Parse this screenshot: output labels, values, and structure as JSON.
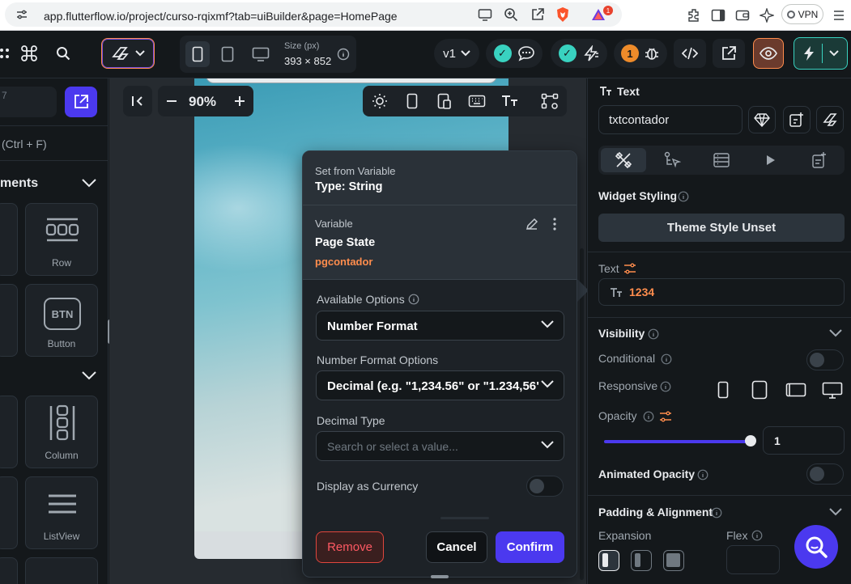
{
  "browser": {
    "url": "app.flutterflow.io/project/curso-rqixmf?tab=uiBuilder&page=HomePage",
    "vpn_label": "VPN",
    "badge_count": "1"
  },
  "toolbar": {
    "size_label": "Size (px)",
    "size_value": "393 × 852",
    "version": "v1",
    "warning_count": "1"
  },
  "left_panel": {
    "search_hint": "(Ctrl + F)",
    "section_title": "ments",
    "widgets": [
      "Row",
      "Button",
      "Column",
      "ListView"
    ],
    "btn_icon_text": "BTN"
  },
  "canvas": {
    "zoom": "90%",
    "minus_label": "-"
  },
  "popup": {
    "header_label": "Set from Variable",
    "type_label": "Type: String",
    "variable_label": "Variable",
    "variable_source": "Page State",
    "variable_name": "pgcontador",
    "available_options_label": "Available Options",
    "available_options_value": "Number Format",
    "number_format_label": "Number Format Options",
    "number_format_value": "Decimal (e.g. \"1,234.56\" or \"1.234,56\")",
    "decimal_type_label": "Decimal Type",
    "decimal_type_placeholder": "Search or select a value...",
    "currency_label": "Display as Currency",
    "remove_label": "Remove",
    "cancel_label": "Cancel",
    "confirm_label": "Confirm"
  },
  "right_panel": {
    "widget_type": "Text",
    "widget_name": "txtcontador",
    "widget_styling_label": "Widget Styling",
    "theme_style_label": "Theme Style Unset",
    "text_label": "Text",
    "text_value": "1234",
    "visibility_label": "Visibility",
    "conditional_label": "Conditional",
    "responsive_label": "Responsive",
    "opacity_label": "Opacity",
    "opacity_value": "1",
    "animated_opacity_label": "Animated Opacity",
    "padding_label": "Padding & Alignment",
    "expansion_label": "Expansion",
    "flex_label": "Flex"
  },
  "colors": {
    "accent": "#4b39ef",
    "orange": "#ff8d4d",
    "teal": "#39d2c0",
    "error": "#ff5963"
  }
}
